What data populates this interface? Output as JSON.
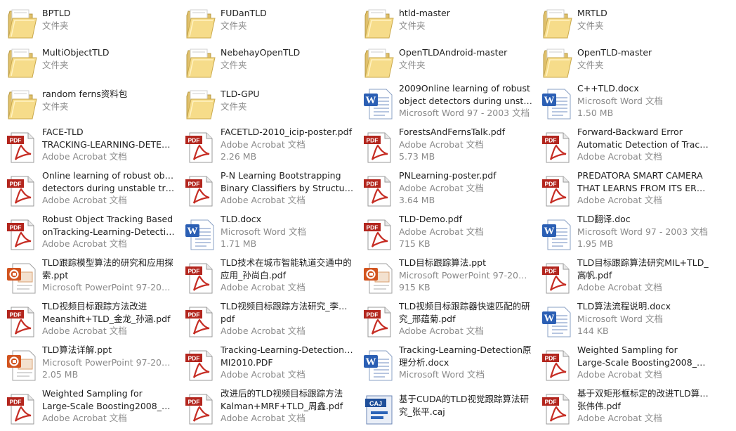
{
  "explorer": {
    "view": "tiles",
    "type_labels": {
      "folder": "文件夹",
      "pdf": "Adobe Acrobat 文档",
      "word": "Microsoft Word 文档",
      "word97": "Microsoft Word 97 - 2003 文档",
      "ppt97": "Microsoft PowerPoint 97-2003..."
    },
    "items": [
      {
        "kind": "folder",
        "lines": [
          "BPTLD"
        ],
        "type": "文件夹"
      },
      {
        "kind": "folder",
        "lines": [
          "FUDanTLD"
        ],
        "type": "文件夹"
      },
      {
        "kind": "folder",
        "lines": [
          "htld-master"
        ],
        "type": "文件夹"
      },
      {
        "kind": "folder",
        "lines": [
          "MRTLD"
        ],
        "type": "文件夹"
      },
      {
        "kind": "folder",
        "lines": [
          "MultiObjectTLD"
        ],
        "type": "文件夹"
      },
      {
        "kind": "folder",
        "lines": [
          "NebehayOpenTLD"
        ],
        "type": "文件夹"
      },
      {
        "kind": "folder",
        "lines": [
          "OpenTLDAndroid-master"
        ],
        "type": "文件夹"
      },
      {
        "kind": "folder",
        "lines": [
          "OpenTLD-master"
        ],
        "type": "文件夹"
      },
      {
        "kind": "folder",
        "lines": [
          "random ferns资料包"
        ],
        "type": "文件夹"
      },
      {
        "kind": "folder",
        "lines": [
          "TLD-GPU"
        ],
        "type": "文件夹"
      },
      {
        "kind": "word",
        "lines": [
          "2009Online learning of robust",
          "object detectors during unsta..."
        ],
        "type": "Microsoft Word 97 - 2003 文档"
      },
      {
        "kind": "word",
        "lines": [
          "C++TLD.docx"
        ],
        "type": "Microsoft Word 文档",
        "size": "1.50 MB"
      },
      {
        "kind": "pdf",
        "lines": [
          "FACE-TLD",
          "TRACKING-LEARNING-DETEC..."
        ],
        "type": "Adobe Acrobat 文档"
      },
      {
        "kind": "pdf",
        "lines": [
          "FACETLD-2010_icip-poster.pdf"
        ],
        "type": "Adobe Acrobat 文档",
        "size": "2.26 MB"
      },
      {
        "kind": "pdf",
        "lines": [
          "ForestsAndFernsTalk.pdf"
        ],
        "type": "Adobe Acrobat 文档",
        "size": "5.73 MB"
      },
      {
        "kind": "pdf",
        "lines": [
          "Forward-Backward Error",
          "Automatic Detection of Tracki..."
        ],
        "type": "Adobe Acrobat 文档"
      },
      {
        "kind": "pdf",
        "lines": [
          "Online learning of robust object",
          "detectors during unstable trac..."
        ],
        "type": "Adobe Acrobat 文档"
      },
      {
        "kind": "pdf",
        "lines": [
          "P-N Learning Bootstrapping",
          "Binary Classifiers by Structural..."
        ],
        "type": "Adobe Acrobat 文档"
      },
      {
        "kind": "pdf",
        "lines": [
          "PNLearning-poster.pdf"
        ],
        "type": "Adobe Acrobat 文档",
        "size": "3.64 MB"
      },
      {
        "kind": "pdf",
        "lines": [
          "PREDATORA SMART CAMERA",
          "THAT LEARNS FROM ITS ERR..."
        ],
        "type": "Adobe Acrobat 文档"
      },
      {
        "kind": "pdf",
        "lines": [
          "Robust Object Tracking Based",
          "onTracking-Learning-Detectio..."
        ],
        "type": "Adobe Acrobat 文档"
      },
      {
        "kind": "word",
        "lines": [
          "TLD.docx"
        ],
        "type": "Microsoft Word 文档",
        "size": "1.71 MB"
      },
      {
        "kind": "pdf",
        "lines": [
          "TLD-Demo.pdf"
        ],
        "type": "Adobe Acrobat 文档",
        "size": "715 KB"
      },
      {
        "kind": "word",
        "lines": [
          "TLD翻译.doc"
        ],
        "type": "Microsoft Word 97 - 2003 文档",
        "size": "1.95 MB"
      },
      {
        "kind": "ppt",
        "lines": [
          "TLD跟踪模型算法的研究和应用探",
          "索.ppt"
        ],
        "type": "Microsoft PowerPoint 97-2003..."
      },
      {
        "kind": "pdf",
        "lines": [
          "TLD技术在城市智能轨道交通中的",
          "应用_孙尚白.pdf"
        ],
        "type": "Adobe Acrobat 文档"
      },
      {
        "kind": "ppt",
        "lines": [
          "TLD目标跟踪算法.ppt"
        ],
        "type": "Microsoft PowerPoint 97-2003...",
        "size": "915 KB"
      },
      {
        "kind": "pdf",
        "lines": [
          "TLD目标跟踪算法研究MIL+TLD_",
          "高帆.pdf"
        ],
        "type": "Adobe Acrobat 文档"
      },
      {
        "kind": "pdf",
        "lines": [
          "TLD视频目标跟踪方法改进",
          "Meanshift+TLD_金龙_孙涵.pdf"
        ],
        "type": "Adobe Acrobat 文档"
      },
      {
        "kind": "pdf",
        "lines": [
          "TLD视频目标跟踪方法研究_李妮妮.",
          "pdf"
        ],
        "type": "Adobe Acrobat 文档"
      },
      {
        "kind": "pdf",
        "lines": [
          "TLD视频目标跟踪器快速匹配的研",
          "究_邢蕴菊.pdf"
        ],
        "type": "Adobe Acrobat 文档"
      },
      {
        "kind": "word",
        "lines": [
          "TLD算法流程说明.docx"
        ],
        "type": "Microsoft Word 文档",
        "size": "144 KB"
      },
      {
        "kind": "ppt",
        "lines": [
          "TLD算法详解.ppt"
        ],
        "type": "Microsoft PowerPoint 97-2003...",
        "size": "2.05 MB"
      },
      {
        "kind": "pdf",
        "lines": [
          "Tracking-Learning-DetectionPA",
          "MI2010.PDF"
        ],
        "type": "Adobe Acrobat 文档"
      },
      {
        "kind": "word",
        "lines": [
          "Tracking-Learning-Detection原",
          "理分析.docx"
        ],
        "type": "Microsoft Word 文档"
      },
      {
        "kind": "pdf",
        "lines": [
          "Weighted Sampling for",
          "Large-Scale Boosting2008_bm..."
        ],
        "type": "Adobe Acrobat 文档"
      },
      {
        "kind": "pdf",
        "lines": [
          "Weighted Sampling for",
          "Large-Scale Boosting2008_bm..."
        ],
        "type": "Adobe Acrobat 文档"
      },
      {
        "kind": "pdf",
        "lines": [
          "改进后的TLD视频目标跟踪方法",
          "Kalman+MRF+TLD_周鑫.pdf"
        ],
        "type": "Adobe Acrobat 文档"
      },
      {
        "kind": "caj",
        "lines": [
          "基于CUDA的TLD视觉跟踪算法研",
          "究_张平.caj"
        ],
        "type": ""
      },
      {
        "kind": "pdf",
        "lines": [
          "基于双矩形框标定的改进TLD算法_",
          "张伟伟.pdf"
        ],
        "type": "Adobe Acrobat 文档"
      }
    ]
  }
}
